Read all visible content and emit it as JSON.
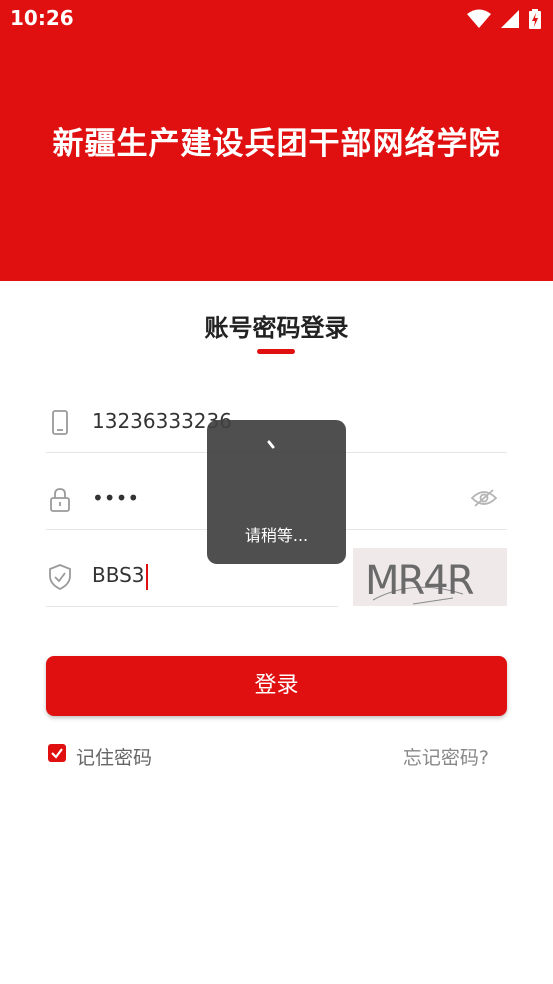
{
  "status_bar": {
    "time": "10:26",
    "icons": [
      "wifi-icon",
      "cellular-signal-icon",
      "battery-charging-icon"
    ]
  },
  "header": {
    "title": "新疆生产建设兵团干部网络学院",
    "background_color": "#e01010"
  },
  "login": {
    "title": "账号密码登录",
    "account": {
      "icon": "phone-icon",
      "value": "13236333236"
    },
    "password": {
      "icon": "lock-icon",
      "value": "••••",
      "toggle_icon": "eye-off-icon"
    },
    "captcha": {
      "icon": "shield-check-icon",
      "value": "BBS3",
      "image_text": "MR4R"
    },
    "submit_label": "登录",
    "remember": {
      "label": "记住密码",
      "checked": true
    },
    "forgot_label": "忘记密码?"
  },
  "loading_toast": {
    "text": "请稍等..."
  },
  "colors": {
    "accent": "#e01010",
    "toast_bg": "#404040"
  }
}
